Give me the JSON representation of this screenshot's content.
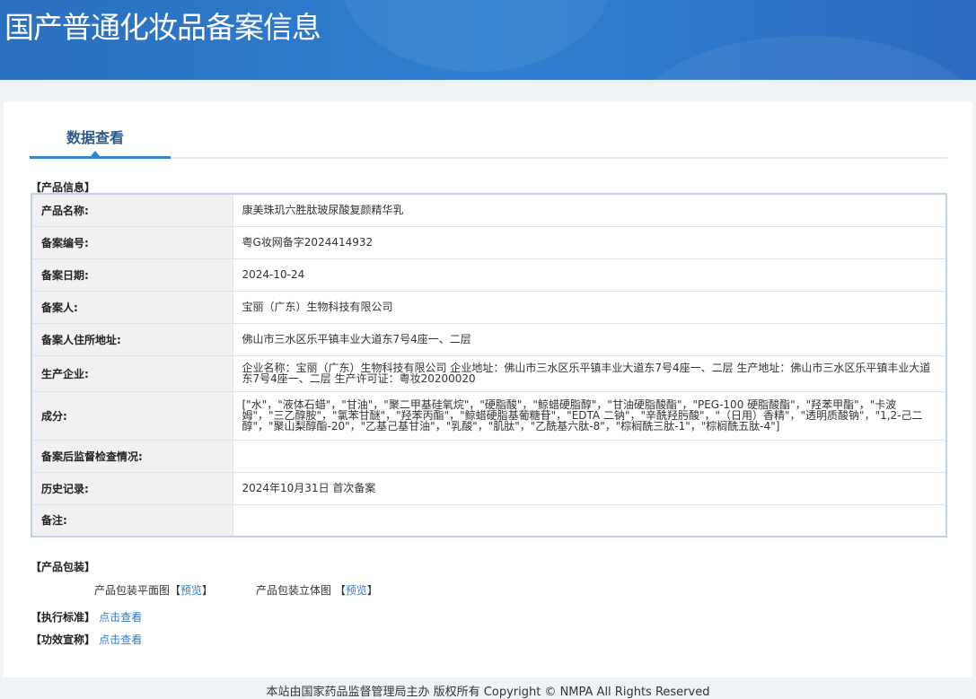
{
  "header": {
    "title": "国产普通化妆品备案信息"
  },
  "tab": {
    "label": "数据查看"
  },
  "product_info": {
    "section_title": "【产品信息】",
    "rows": [
      {
        "label": "产品名称:",
        "value": "康美珠玑六胜肽玻尿酸复颜精华乳"
      },
      {
        "label": "备案编号:",
        "value": "粤G妆网备字2024414932"
      },
      {
        "label": "备案日期:",
        "value": "2024-10-24"
      },
      {
        "label": "备案人:",
        "value": "宝丽（广东）生物科技有限公司"
      },
      {
        "label": "备案人住所地址:",
        "value": "佛山市三水区乐平镇丰业大道东7号4座一、二层"
      },
      {
        "label": "生产企业:",
        "value": "企业名称：宝丽（广东）生物科技有限公司 企业地址：佛山市三水区乐平镇丰业大道东7号4座一、二层 生产地址：佛山市三水区乐平镇丰业大道东7号4座一、二层 生产许可证：粤妆20200020"
      },
      {
        "label": "成分:",
        "value": "[\"水\"，\"液体石蜡\"，\"甘油\"，\"聚二甲基硅氧烷\"，\"硬脂酸\"，\"鲸蜡硬脂醇\"，\"甘油硬脂酸酯\"，\"PEG-100 硬脂酸酯\"，\"羟苯甲酯\"，\"卡波姆\"，\"三乙醇胺\"，\"氯苯甘醚\"，\"羟苯丙酯\"，\"鲸蜡硬脂基葡糖苷\"，\"EDTA 二钠\"，\"辛酰羟肟酸\"，\"（日用）香精\"，\"透明质酸钠\"，\"1,2-己二醇\"，\"聚山梨醇酯-20\"，\"乙基己基甘油\"，\"乳酸\"，\"肌肽\"，\"乙酰基六肽-8\"，\"棕榈酰三肽-1\"，\"棕榈酰五肽-4\"]"
      },
      {
        "label": "备案后监督检查情况:",
        "value": ""
      },
      {
        "label": "历史记录:",
        "value": "2024年10月31日 首次备案"
      },
      {
        "label": "备注:",
        "value": ""
      }
    ]
  },
  "packaging": {
    "section_title": "【产品包装】",
    "flat_label": "产品包装平面图",
    "solid_label": "产品包装立体图",
    "bracket_open": "【",
    "bracket_close": "】",
    "preview": "预览"
  },
  "standard": {
    "section_title": "【执行标准】",
    "link": "点击查看"
  },
  "efficacy": {
    "section_title": "【功效宣称】",
    "link": "点击查看"
  },
  "footer": {
    "text": "本站由国家药品监督管理局主办 版权所有 Copyright © NMPA All Rights Reserved"
  }
}
